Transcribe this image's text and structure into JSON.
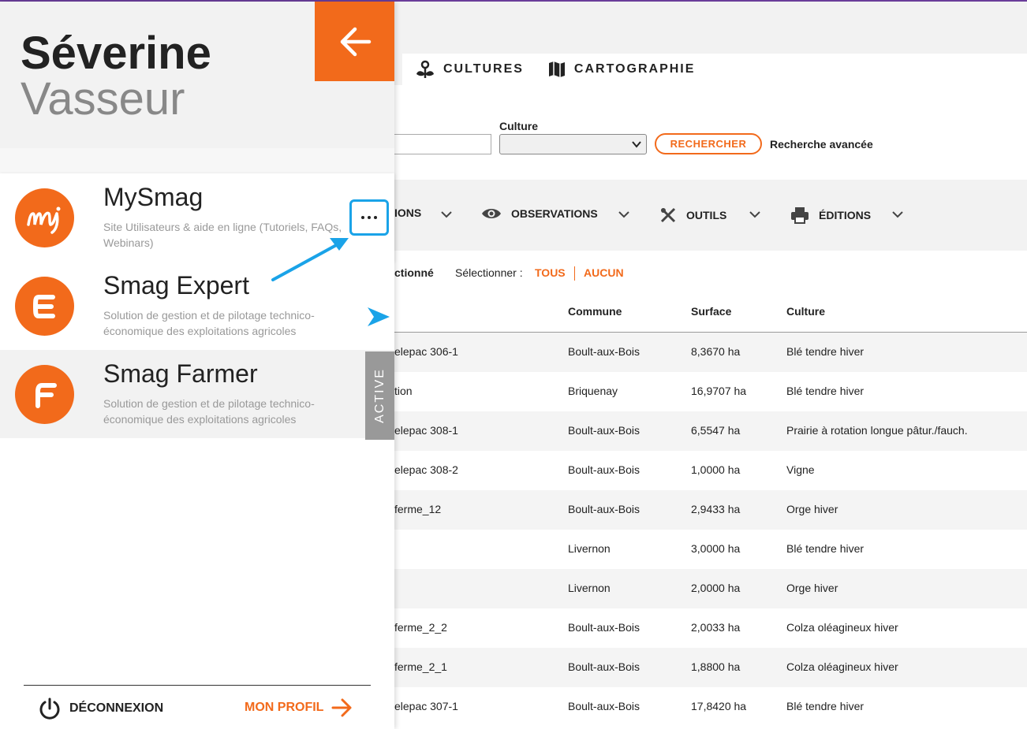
{
  "user": {
    "first_name": "Séverine",
    "last_name": "Vasseur"
  },
  "nav": {
    "cultures": "CULTURES",
    "cartographie": "CARTOGRAPHIE"
  },
  "search": {
    "culture_label": "Culture",
    "search_button": "RECHERCHER",
    "advanced_link": "Recherche avancée"
  },
  "toolbar": {
    "partial_item": "IONS",
    "observations": "OBSERVATIONS",
    "outils": "OUTILS",
    "editions": "ÉDITIONS"
  },
  "selection": {
    "partial_text": "ctionné",
    "label": "Sélectionner :",
    "all": "TOUS",
    "none": "AUCUN"
  },
  "table": {
    "headers": {
      "commune": "Commune",
      "surface": "Surface",
      "culture": "Culture"
    },
    "rows": [
      {
        "name": "elepac 306-1",
        "commune": "Boult-aux-Bois",
        "surface": "8,3670 ha",
        "culture": "Blé tendre hiver"
      },
      {
        "name": "tion",
        "commune": "Briquenay",
        "surface": "16,9707 ha",
        "culture": "Blé tendre hiver"
      },
      {
        "name": "elepac 308-1",
        "commune": "Boult-aux-Bois",
        "surface": "6,5547 ha",
        "culture": "Prairie à rotation longue pâtur./fauch."
      },
      {
        "name": "elepac 308-2",
        "commune": "Boult-aux-Bois",
        "surface": "1,0000 ha",
        "culture": "Vigne"
      },
      {
        "name": " ferme_12",
        "commune": "Boult-aux-Bois",
        "surface": "2,9433 ha",
        "culture": "Orge hiver"
      },
      {
        "name": "",
        "commune": "Livernon",
        "surface": "3,0000 ha",
        "culture": "Blé tendre hiver"
      },
      {
        "name": "",
        "commune": "Livernon",
        "surface": "2,0000 ha",
        "culture": "Orge hiver"
      },
      {
        "name": " ferme_2_2",
        "commune": "Boult-aux-Bois",
        "surface": "2,0033 ha",
        "culture": "Colza oléagineux hiver"
      },
      {
        "name": " ferme_2_1",
        "commune": "Boult-aux-Bois",
        "surface": "1,8800 ha",
        "culture": "Colza oléagineux hiver"
      },
      {
        "name": "elepac 307-1",
        "commune": "Boult-aux-Bois",
        "surface": "17,8420 ha",
        "culture": "Blé tendre hiver"
      }
    ]
  },
  "apps": [
    {
      "title": "MySmag",
      "description": "Site Utilisateurs & aide en ligne (Tutoriels, FAQs, Webinars)",
      "logo_text": "My"
    },
    {
      "title": "Smag Expert",
      "description": "Solution de gestion et de pilotage technico-économique des exploitations agricoles",
      "logo_text": "E"
    },
    {
      "title": "Smag Farmer",
      "description": "Solution de gestion et de pilotage technico-économique des exploitations agricoles",
      "logo_text": "F"
    }
  ],
  "active_label": "ACTIVE",
  "footer": {
    "logout": "DÉCONNEXION",
    "profile": "MON PROFIL"
  },
  "colors": {
    "brand": "#f26a1b",
    "highlight": "#1aa3e8",
    "header_bg": "#f2f2f2",
    "active_tab": "#999999"
  }
}
